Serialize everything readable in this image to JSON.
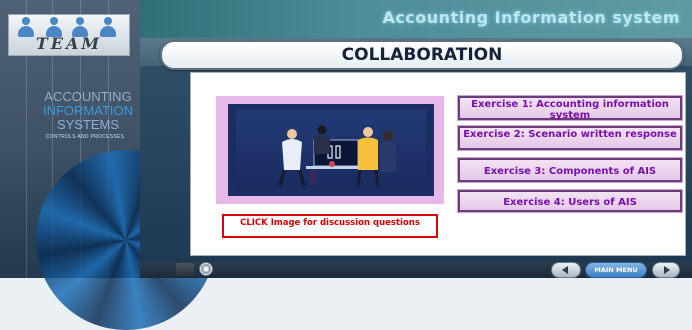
{
  "header": {
    "app_title": "Accounting Information system",
    "page_title": "COLLABORATION"
  },
  "cover": {
    "logo_text": "TEAM",
    "title_lines": [
      "ACCOUNTING",
      "INFORMATION",
      "SYSTEMS"
    ],
    "subtitle": "CONTROLS AND PROCESSES"
  },
  "main": {
    "image_caption": "CLICK Image for discussion questions",
    "exercises": [
      {
        "label": "Exercise 1: Accounting information system"
      },
      {
        "label": "Exercise 2: Scenario written response"
      },
      {
        "label": "Exercise 3: Components of AIS"
      },
      {
        "label": "Exercise 4: Users of AIS"
      }
    ]
  },
  "footer": {
    "main_menu_label": "MAIN MENU"
  },
  "colors": {
    "exercise_text": "#7a0fb0",
    "discussion_border": "#dd0000",
    "accent_teal": "#4e8e98"
  },
  "icons": {
    "back": "back-icon",
    "record": "record-icon",
    "prev": "prev-arrow-icon",
    "next": "next-arrow-icon"
  }
}
